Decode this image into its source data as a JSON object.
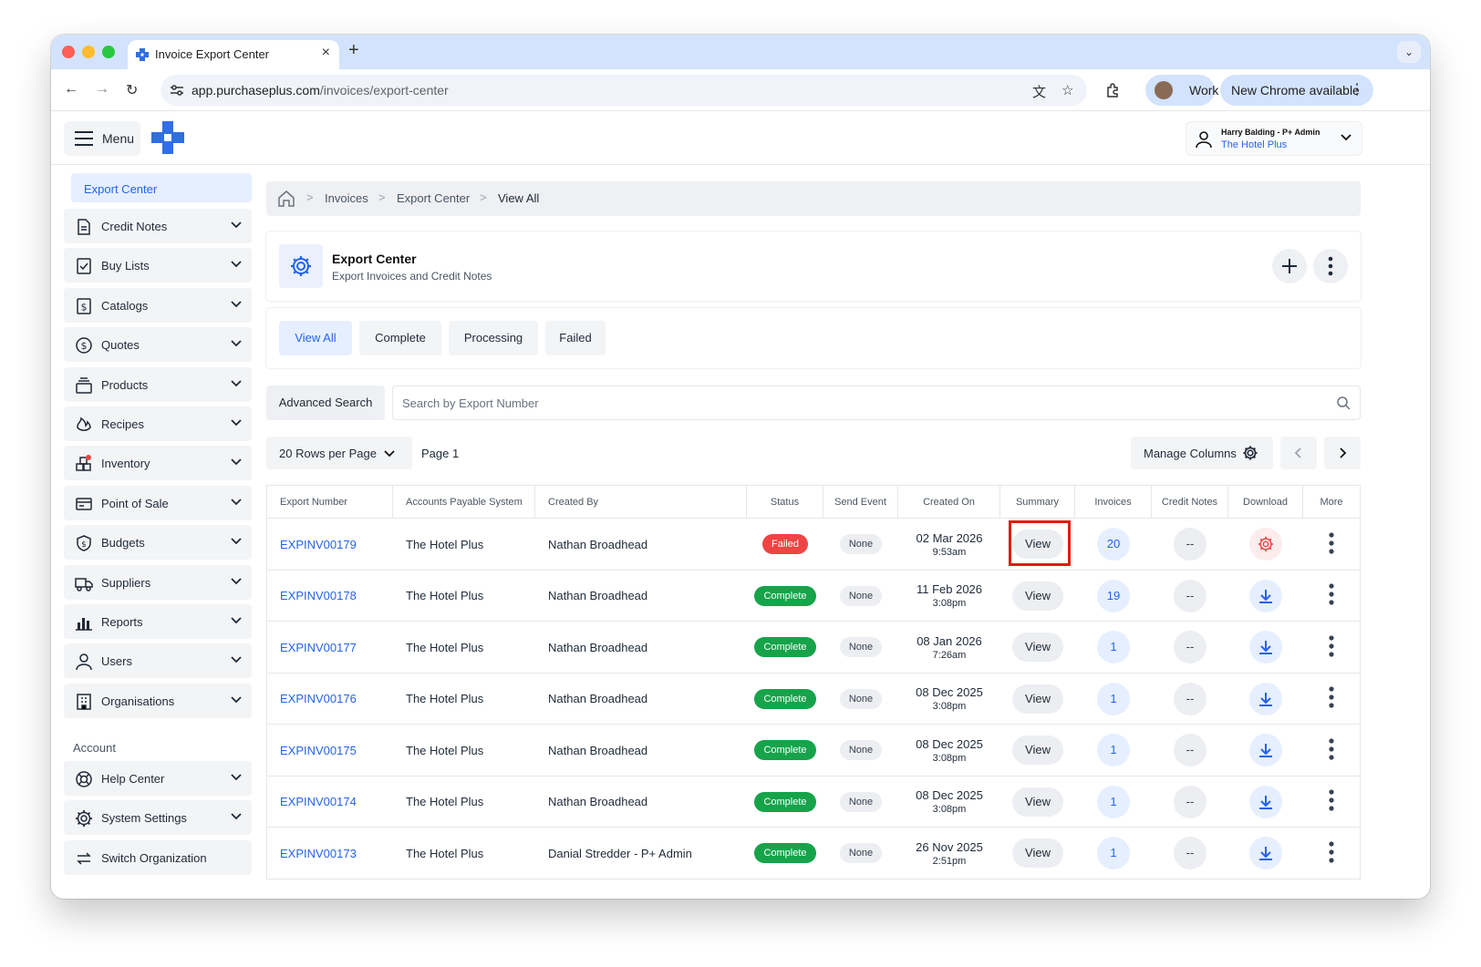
{
  "browser": {
    "tab_title": "Invoice Export Center",
    "url_host": "app.purchaseplus.com",
    "url_path": "/invoices/export-center",
    "profile_label": "Work",
    "update_label": "New Chrome available"
  },
  "header": {
    "menu_label": "Menu",
    "user_name": "Harry Balding - P+ Admin",
    "user_org": "The Hotel Plus"
  },
  "sidebar": {
    "active_item": "Export Center",
    "items": [
      {
        "label": "Credit Notes",
        "icon": "document-icon"
      },
      {
        "label": "Buy Lists",
        "icon": "checklist-icon"
      },
      {
        "label": "Catalogs",
        "icon": "dollar-document-icon"
      },
      {
        "label": "Quotes",
        "icon": "dollar-circle-icon"
      },
      {
        "label": "Products",
        "icon": "stack-icon"
      },
      {
        "label": "Recipes",
        "icon": "flame-icon"
      },
      {
        "label": "Inventory",
        "icon": "boxes-icon"
      },
      {
        "label": "Point of Sale",
        "icon": "card-icon"
      },
      {
        "label": "Budgets",
        "icon": "shield-dollar-icon"
      },
      {
        "label": "Suppliers",
        "icon": "truck-icon"
      },
      {
        "label": "Reports",
        "icon": "bar-chart-icon"
      },
      {
        "label": "Users",
        "icon": "user-icon"
      },
      {
        "label": "Organisations",
        "icon": "building-icon"
      }
    ],
    "account_heading": "Account",
    "account_items": [
      {
        "label": "Help Center",
        "icon": "lifebuoy-icon"
      },
      {
        "label": "System Settings",
        "icon": "gear-icon"
      },
      {
        "label": "Switch Organization",
        "icon": "switch-icon"
      }
    ]
  },
  "breadcrumb": [
    "Invoices",
    "Export Center",
    "View All"
  ],
  "page": {
    "title": "Export Center",
    "subtitle": "Export Invoices and Credit Notes"
  },
  "filters": [
    "View All",
    "Complete",
    "Processing",
    "Failed"
  ],
  "search": {
    "advanced_label": "Advanced Search",
    "placeholder": "Search by Export Number"
  },
  "pagination": {
    "rows_label": "20 Rows per Page",
    "page_label": "Page 1",
    "manage_columns_label": "Manage Columns"
  },
  "table": {
    "columns": [
      "Export Number",
      "Accounts Payable System",
      "Created By",
      "Status",
      "Send Event",
      "Created On",
      "Summary",
      "Invoices",
      "Credit Notes",
      "Download",
      "More"
    ],
    "rows": [
      {
        "export_number": "EXPINV00179",
        "ap_system": "The Hotel Plus",
        "created_by": "Nathan Broadhead",
        "status": "Failed",
        "send_event": "None",
        "date": "02 Mar 2026",
        "time": "9:53am",
        "summary": "View",
        "invoices": "20",
        "credit_notes": "--",
        "download": "failed"
      },
      {
        "export_number": "EXPINV00178",
        "ap_system": "The Hotel Plus",
        "created_by": "Nathan Broadhead",
        "status": "Complete",
        "send_event": "None",
        "date": "11 Feb 2026",
        "time": "3:08pm",
        "summary": "View",
        "invoices": "19",
        "credit_notes": "--",
        "download": "ok"
      },
      {
        "export_number": "EXPINV00177",
        "ap_system": "The Hotel Plus",
        "created_by": "Nathan Broadhead",
        "status": "Complete",
        "send_event": "None",
        "date": "08 Jan 2026",
        "time": "7:26am",
        "summary": "View",
        "invoices": "1",
        "credit_notes": "--",
        "download": "ok"
      },
      {
        "export_number": "EXPINV00176",
        "ap_system": "The Hotel Plus",
        "created_by": "Nathan Broadhead",
        "status": "Complete",
        "send_event": "None",
        "date": "08 Dec 2025",
        "time": "3:08pm",
        "summary": "View",
        "invoices": "1",
        "credit_notes": "--",
        "download": "ok"
      },
      {
        "export_number": "EXPINV00175",
        "ap_system": "The Hotel Plus",
        "created_by": "Nathan Broadhead",
        "status": "Complete",
        "send_event": "None",
        "date": "08 Dec 2025",
        "time": "3:08pm",
        "summary": "View",
        "invoices": "1",
        "credit_notes": "--",
        "download": "ok"
      },
      {
        "export_number": "EXPINV00174",
        "ap_system": "The Hotel Plus",
        "created_by": "Nathan Broadhead",
        "status": "Complete",
        "send_event": "None",
        "date": "08 Dec 2025",
        "time": "3:08pm",
        "summary": "View",
        "invoices": "1",
        "credit_notes": "--",
        "download": "ok"
      },
      {
        "export_number": "EXPINV00173",
        "ap_system": "The Hotel Plus",
        "created_by": "Danial Stredder - P+ Admin",
        "status": "Complete",
        "send_event": "None",
        "date": "26 Nov 2025",
        "time": "2:51pm",
        "summary": "View",
        "invoices": "1",
        "credit_notes": "--",
        "download": "ok"
      }
    ]
  },
  "colors": {
    "accent": "#2563eb",
    "failed": "#ef4444",
    "complete": "#16a34a",
    "highlight": "#e11d0e"
  }
}
